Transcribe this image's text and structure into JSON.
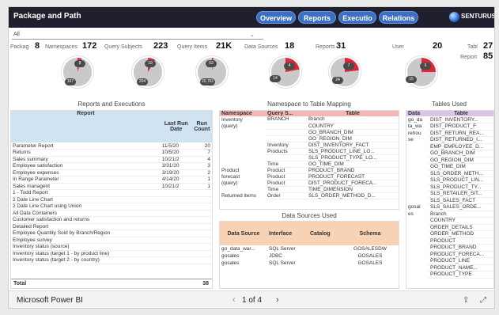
{
  "app": {
    "title": "Package and Path"
  },
  "nav": [
    "Overview",
    "Reports",
    "Executio",
    "Relations"
  ],
  "brand": "SENTURUS",
  "filter": {
    "value": "All"
  },
  "kpis": [
    {
      "label": "Packag",
      "value": "8"
    },
    {
      "label": "Namespaces",
      "value": "172"
    },
    {
      "label": "Query Subjects",
      "value": "223"
    },
    {
      "label": "Query Items",
      "value": "21K"
    },
    {
      "label": "Data Sources",
      "value": "18"
    },
    {
      "label": "Reports",
      "value": "31"
    },
    {
      "label": "User",
      "value": "20"
    },
    {
      "label": "Tabl",
      "value": "27"
    },
    {
      "label": "Report",
      "value": "85"
    }
  ],
  "pies": [
    {
      "small": "8",
      "large": "167",
      "fraction": 0.05
    },
    {
      "small": "19",
      "large": "204",
      "fraction": 0.085
    },
    {
      "small": "53",
      "large": "20,761",
      "fraction": 0.003
    },
    {
      "small": "4",
      "large": "14",
      "fraction": 0.22
    },
    {
      "small": "7",
      "large": "24",
      "fraction": 0.23
    },
    {
      "small": "5",
      "large": "15",
      "fraction": 0.25
    }
  ],
  "sections": {
    "reports": "Reports and Executions",
    "mapping": "Namespace to Table Mapping",
    "tables": "Tables Used",
    "datasources": "Data Sources Used"
  },
  "reports_table": {
    "headers": [
      "Report",
      "Last Run Date",
      "Run Count"
    ],
    "rows": [
      [
        "Parameter Report",
        "11/5/20",
        "20"
      ],
      [
        "Returns",
        "10/5/20",
        "7"
      ],
      [
        "Sales summary",
        "10/21/2",
        "4"
      ],
      [
        "Employee satisfaction",
        "3/31/20",
        "3"
      ],
      [
        "Employee expenses",
        "3/19/20",
        "2"
      ],
      [
        "In Range Parameter",
        "4/14/20",
        "1"
      ],
      [
        "Sales managent",
        "10/21/2",
        "1"
      ],
      [
        "1 - Todd Report",
        "",
        ""
      ],
      [
        "2 Date Line Chart",
        "",
        ""
      ],
      [
        "2 Date Line Chart using Union",
        "",
        ""
      ],
      [
        "All Data Containers",
        "",
        ""
      ],
      [
        "Customer satisfaction and returns",
        "",
        ""
      ],
      [
        "Detailed Report",
        "",
        ""
      ],
      [
        "Employee Quantity Sold by Branch/Region",
        "",
        ""
      ],
      [
        "Employee survey",
        "",
        ""
      ],
      [
        "Inventory status (source)",
        "",
        ""
      ],
      [
        "Inventory status (target 1 - by product line)",
        "",
        ""
      ],
      [
        "Inventory status (target 2 - by country)",
        "",
        ""
      ]
    ],
    "total_label": "Total",
    "total_value": "38"
  },
  "mapping_table": {
    "headers": [
      "Namespace",
      "Query S...",
      "Table"
    ],
    "rows": [
      [
        "Inventory",
        "BRANCH",
        "Branch"
      ],
      [
        "(query)",
        "",
        "COUNTRY"
      ],
      [
        "",
        "",
        "GO_BRANCH_DIM"
      ],
      [
        "",
        "",
        "GO_REGION_DIM"
      ],
      [
        "",
        "Inventory",
        "DIST_INVENTORY_FACT"
      ],
      [
        "",
        "Products",
        "SLS_PRODUCT_LINE_LO..."
      ],
      [
        "",
        "",
        "SLS_PRODUCT_TYPE_LO..."
      ],
      [
        "",
        "Time",
        "GO_TIME_DIM"
      ],
      [
        "Product",
        "Product",
        "PRODUCT_BRAND"
      ],
      [
        "forecast",
        "Product",
        "PRODUCT_FORECAST"
      ],
      [
        "(query)",
        "Product",
        "DIST_PRODUCT_FORECA..."
      ],
      [
        "",
        "Time",
        "TIME_DIMENSION"
      ],
      [
        "Returned items",
        "Order",
        "SLS_ORDER_METHOD_D..."
      ]
    ]
  },
  "tables_used": {
    "headers": [
      "Data",
      "Table"
    ],
    "rows": [
      [
        "go_da",
        "DIST_INVENTORY..."
      ],
      [
        "ta_wa",
        "DIST_PRODUCT_F"
      ],
      [
        "rehou",
        "DIST_RETURN_REA..."
      ],
      [
        "se",
        "DIST_RETURNED_I..."
      ],
      [
        "",
        "EMP_EMPLOYEE_D..."
      ],
      [
        "",
        "GO_BRANCH_DIM"
      ],
      [
        "",
        "GO_REGION_DIM"
      ],
      [
        "",
        "GO_TIME_DIM"
      ],
      [
        "",
        "SLS_ORDER_METH..."
      ],
      [
        "",
        "SLS_PRODUCT_LIN..."
      ],
      [
        "",
        "SLS_PRODUCT_TY..."
      ],
      [
        "",
        "SLS_RETAILER_SIT..."
      ],
      [
        "",
        "SLS_SALES_FACT"
      ],
      [
        "gosal",
        "SLS_SALES_ORDE..."
      ],
      [
        "es",
        "Branch"
      ],
      [
        "",
        "COUNTRY"
      ],
      [
        "",
        "ORDER_DETAILS"
      ],
      [
        "",
        "ORDER_METHOD"
      ],
      [
        "",
        "PRODUCT"
      ],
      [
        "",
        "PRODUCT_BRAND"
      ],
      [
        "",
        "PRODUCT_FORECA..."
      ],
      [
        "",
        "PRODUCT_LINE"
      ],
      [
        "",
        "PRODUCT_NAME..."
      ],
      [
        "",
        "PRODUCT_TYPE"
      ]
    ]
  },
  "datasources_table": {
    "headers": [
      "Data Source",
      "Interface",
      "Catalog",
      "Schema"
    ],
    "rows": [
      [
        "go_data_war...",
        "SQL Server",
        "",
        "GOSALESDW"
      ],
      [
        "gosales",
        "JDBC",
        "",
        "GOSALES"
      ],
      [
        "gosales",
        "SQL Server",
        "",
        "GOSALES"
      ]
    ]
  },
  "footer": {
    "app": "Microsoft Power BI",
    "page": "1 of 4",
    "prev": "‹",
    "next": "›"
  },
  "colors": {
    "accent": "#3b6fc4",
    "pie_highlight": "#d8283a",
    "pie_base": "#c9c9c9",
    "header_blue": "#cfe3f3",
    "header_red": "#f4b6b6",
    "header_peach": "#f7d2b4",
    "header_purple": "#d9c6e6"
  }
}
